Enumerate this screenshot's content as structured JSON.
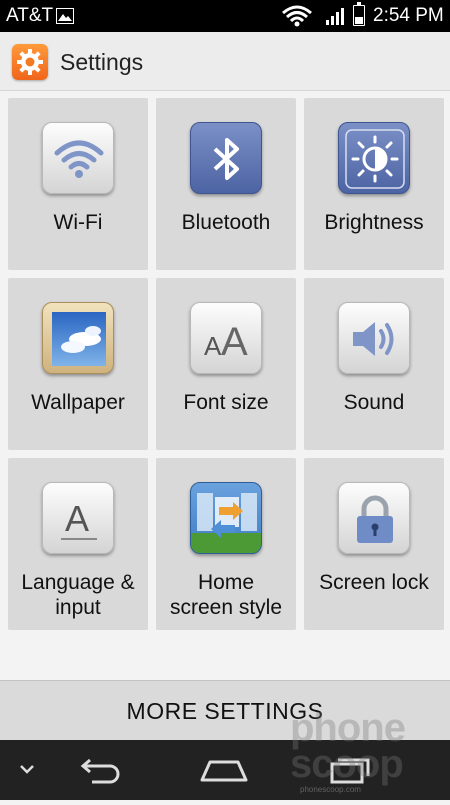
{
  "status_bar": {
    "carrier": "AT&T",
    "time": "2:54 PM",
    "icons": [
      "gallery-icon",
      "wifi-icon",
      "signal-icon",
      "battery-icon"
    ],
    "battery_level": 0.35
  },
  "header": {
    "title": "Settings",
    "icon": "gear-icon",
    "accent": "#f27a22"
  },
  "tiles": [
    {
      "label": "Wi-Fi",
      "icon": "wifi-icon"
    },
    {
      "label": "Bluetooth",
      "icon": "bluetooth-icon"
    },
    {
      "label": "Brightness",
      "icon": "brightness-icon"
    },
    {
      "label": "Wallpaper",
      "icon": "wallpaper-icon"
    },
    {
      "label": "Font size",
      "icon": "font-size-icon"
    },
    {
      "label": "Sound",
      "icon": "speaker-icon"
    },
    {
      "label": "Language & input",
      "line1": "Language &",
      "line2": "input",
      "icon": "language-icon"
    },
    {
      "label": "Home screen style",
      "line1": "Home",
      "line2": "screen style",
      "icon": "home-screen-style-icon"
    },
    {
      "label": "Screen lock",
      "icon": "padlock-icon"
    }
  ],
  "more_settings": {
    "label": "MORE SETTINGS"
  },
  "nav": {
    "icons": [
      "chevron-down-icon",
      "back-icon",
      "home-icon",
      "recent-apps-icon"
    ]
  },
  "watermark": {
    "line1": "phone",
    "line2": "scoop",
    "url": "phonescoop.com"
  }
}
